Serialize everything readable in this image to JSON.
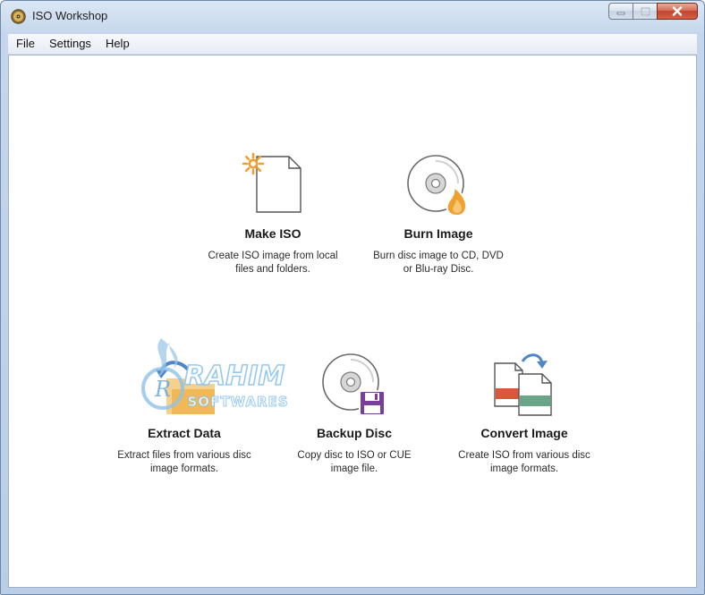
{
  "window": {
    "title": "ISO Workshop",
    "icon": "disc-app-icon"
  },
  "caption_buttons": [
    "minimize-icon",
    "maximize-icon",
    "close-icon"
  ],
  "menu": [
    {
      "label": "File"
    },
    {
      "label": "Settings"
    },
    {
      "label": "Help"
    }
  ],
  "actions": {
    "make_iso": {
      "label": "Make ISO",
      "desc_line1": "Create ISO image from local",
      "desc_line2": "files and folders.",
      "icon": "new-file-icon"
    },
    "burn_image": {
      "label": "Burn Image",
      "desc_line1": "Burn disc image to CD, DVD",
      "desc_line2": "or Blu-ray Disc.",
      "icon": "disc-burn-icon"
    },
    "extract_data": {
      "label": "Extract Data",
      "desc_line1": "Extract files from various disc",
      "desc_line2": "image formats.",
      "icon": "extract-folder-icon"
    },
    "backup_disc": {
      "label": "Backup Disc",
      "desc_line1": "Copy disc to ISO or CUE",
      "desc_line2": "image file.",
      "icon": "disc-save-icon"
    },
    "convert_image": {
      "label": "Convert Image",
      "desc_line1": "Create ISO from various disc",
      "desc_line2": "image formats.",
      "icon": "convert-files-icon"
    }
  },
  "watermark": {
    "line1": "RAHIM",
    "line2": "SOFTWARES",
    "badge": "R"
  },
  "colors": {
    "accent_orange": "#f0a030",
    "disc_gray": "#7a7a7a",
    "save_purple": "#7a3d9a",
    "convert_red": "#d9573b",
    "convert_green": "#6aa58a"
  }
}
